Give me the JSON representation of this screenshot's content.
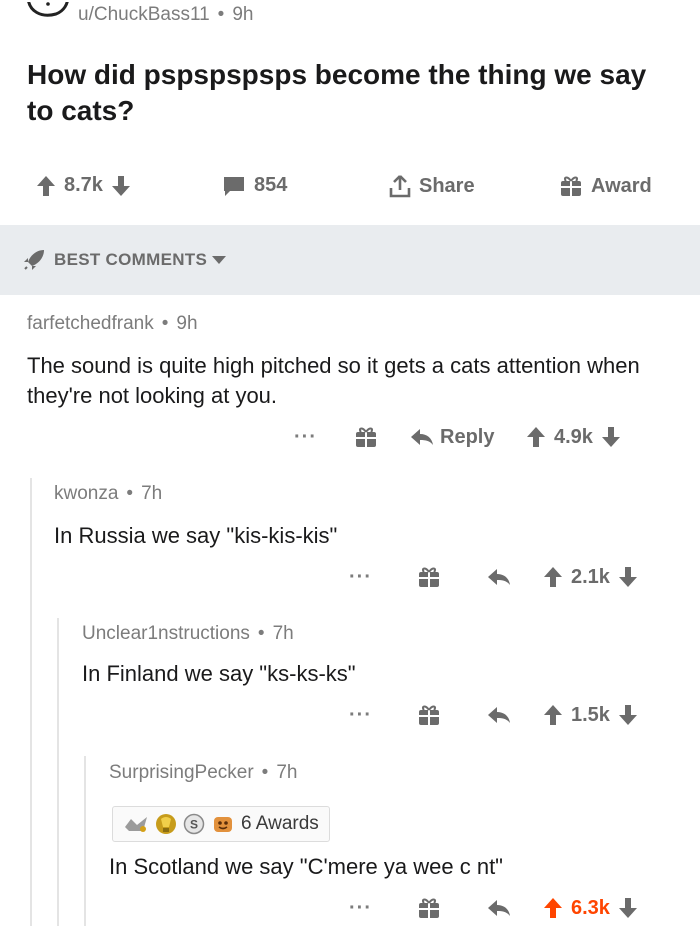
{
  "post": {
    "author": "u/ChuckBass11",
    "age": "9h",
    "title": "How did pspspspsps become the thing we say to cats?",
    "votes": "8.7k",
    "comments_count": "854",
    "share_label": "Share",
    "award_label": "Award"
  },
  "sort": {
    "label": "BEST COMMENTS"
  },
  "comments": [
    {
      "author": "farfetchedfrank",
      "age": "9h",
      "text": "The sound is quite high pitched so it gets a cats attention when they're not looking at you.",
      "reply_label": "Reply",
      "votes": "4.9k",
      "upvoted": false
    },
    {
      "author": "kwonza",
      "age": "7h",
      "text": "In Russia we say \"kis-kis-kis\"",
      "votes": "2.1k",
      "upvoted": false
    },
    {
      "author": "Unclear1nstructions",
      "age": "7h",
      "text": "In Finland we say \"ks-ks-ks\"",
      "votes": "1.5k",
      "upvoted": false
    },
    {
      "author": "SurprisingPecker",
      "age": "7h",
      "awards_label": "6 Awards",
      "text": "In Scotland we say \"C'mere ya wee c  nt\"",
      "votes": "6.3k",
      "upvoted": true
    }
  ],
  "colors": {
    "upvote_active": "#ff4500",
    "meta_gray": "#7c7c7c",
    "bar_gray": "#e9ecef"
  }
}
